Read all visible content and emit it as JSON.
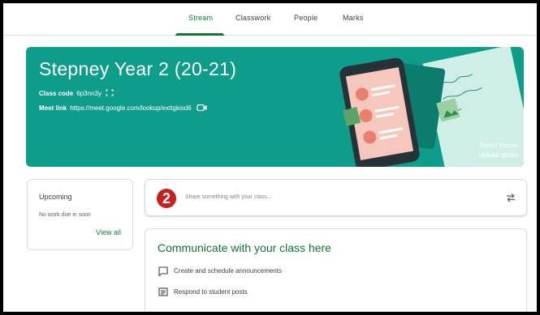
{
  "tabs": [
    {
      "label": "Stream",
      "active": true
    },
    {
      "label": "Classwork",
      "active": false
    },
    {
      "label": "People",
      "active": false
    },
    {
      "label": "Marks",
      "active": false
    }
  ],
  "banner": {
    "title": "Stepney Year 2 (20-21)",
    "class_code_label": "Class code",
    "class_code": "6p3nn3y",
    "meet_link_label": "Meet link",
    "meet_link": "https://meet.google.com/lookup/exttgkisd6",
    "select_theme": "Select theme",
    "upload_photo": "Upload photo",
    "color": "#0f9d8b"
  },
  "upcoming": {
    "title": "Upcoming",
    "empty_text": "No work due in soon",
    "view_all": "View all"
  },
  "share": {
    "avatar_text": "2",
    "placeholder": "Share something with your class..."
  },
  "communicate": {
    "title": "Communicate with your class here",
    "items": [
      {
        "icon": "announcement-icon",
        "label": "Create and schedule announcements"
      },
      {
        "icon": "comment-icon",
        "label": "Respond to student posts"
      }
    ]
  },
  "colors": {
    "accent": "#137333",
    "avatar": "#c5221f"
  }
}
